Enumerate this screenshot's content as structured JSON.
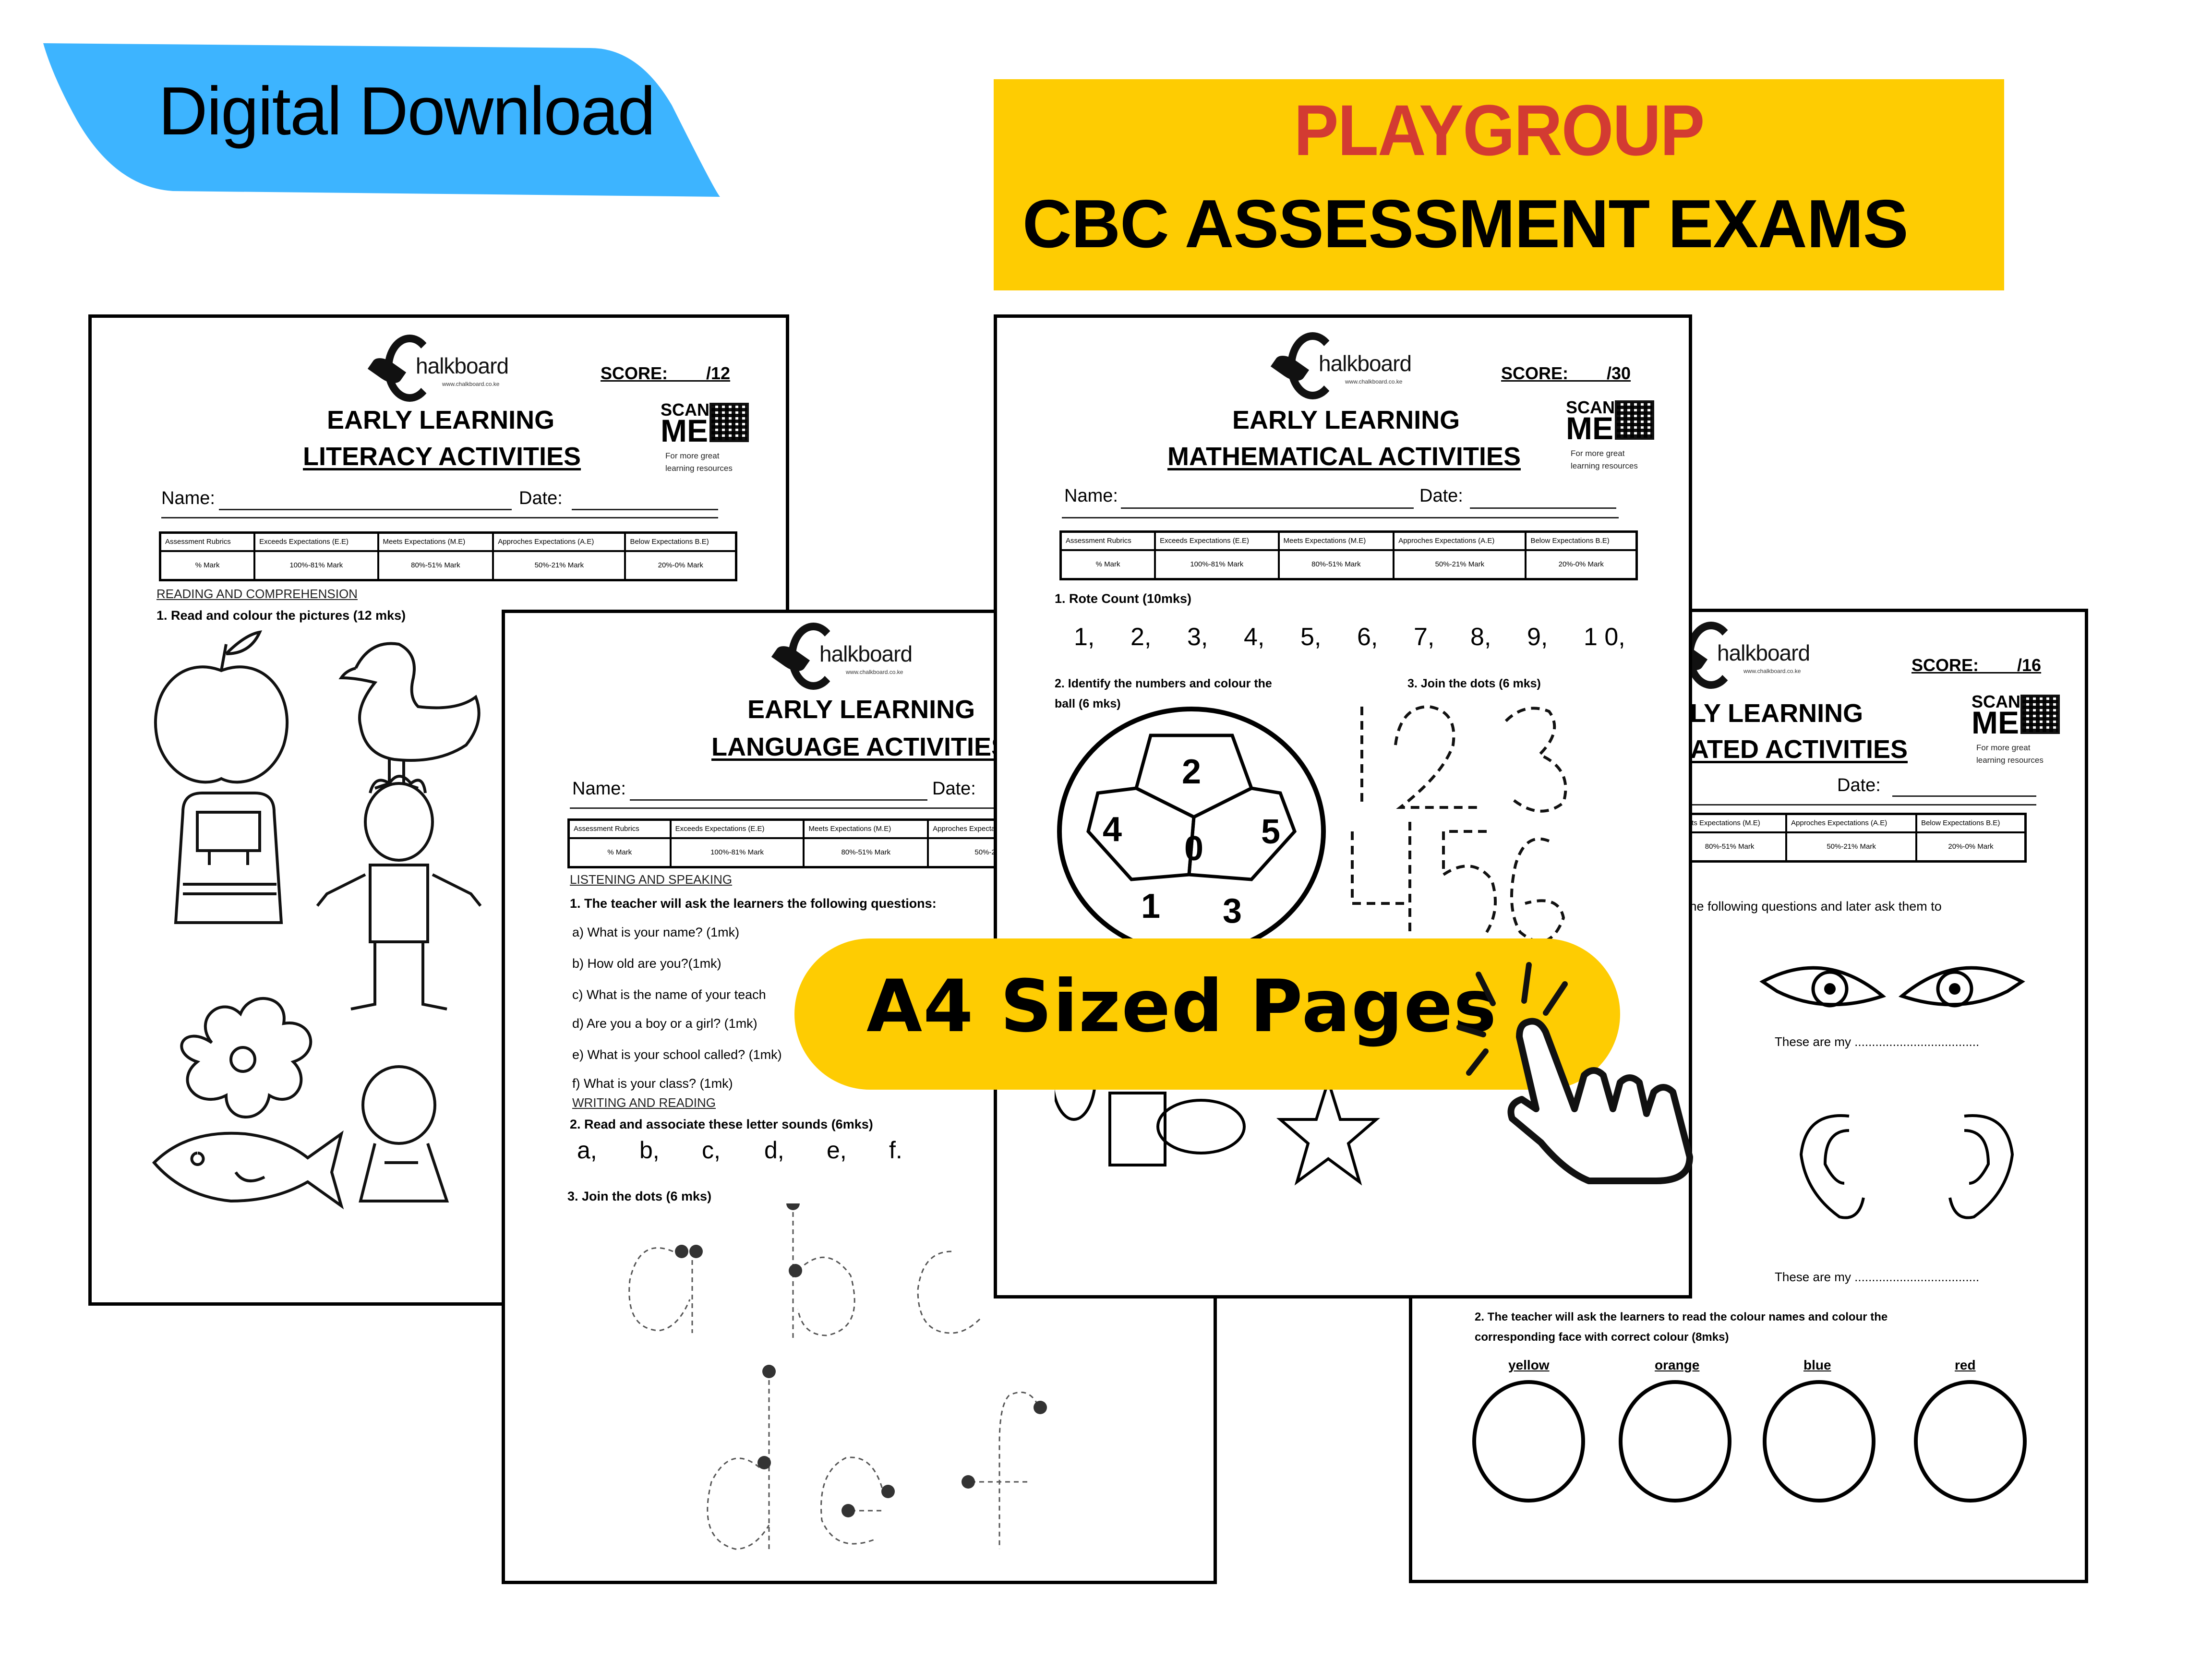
{
  "banner": {
    "label": "Digital Download",
    "color": "#3db4ff"
  },
  "title": {
    "line1": "PLAYGROUP",
    "line2": "CBC ASSESSMENT EXAMS",
    "bg_color": "#fecc02",
    "line1_color": "#d33b32"
  },
  "badge": {
    "label": "A4 Sized Pages",
    "color": "#fecc02"
  },
  "common": {
    "logo_word": "halkboard",
    "logo_url": "www.chalkboard.co.ke",
    "heading": "EARLY LEARNING",
    "scan1": "SCAN",
    "scan2": "ME",
    "scan3a": "For more great",
    "scan3b": "learning resources",
    "name_label": "Name:",
    "date_label": "Date:",
    "rubric": {
      "headers": [
        "Assessment Rubrics",
        "Exceeds Expectations (E.E)",
        "Meets Expectations (M.E)",
        "Approches Expectations (A.E)",
        "Below Expectations B.E)"
      ],
      "row": [
        "% Mark",
        "100%-81% Mark",
        "80%-51% Mark",
        "50%-21% Mark",
        "20%-0%  Mark"
      ]
    }
  },
  "pages": {
    "literacy": {
      "score": "SCORE:        /12",
      "subtitle": "LITERACY ACTIVITIES",
      "section": "READING AND COMPREHENSION",
      "q1": "1. Read and colour the pictures (12 mks)",
      "pictures": [
        "apple",
        "duck",
        "backpack",
        "boy",
        "flower",
        "fish",
        "girl"
      ]
    },
    "language": {
      "subtitle": "LANGUAGE ACTIVITIES",
      "section1": "LISTENING AND SPEAKING",
      "q1": "1. The teacher will ask the learners the following questions:",
      "questions": [
        "a) What is your name? (1mk)",
        "b) How old are you?(1mk)",
        "c) What is the name of your teach",
        "d) Are you a boy or a girl? (1mk)",
        "e) What is your school called? (1mk)",
        "f) What is your class? (1mk)"
      ],
      "section2": "WRITING AND READING",
      "q2": "2. Read and associate these letter sounds (6mks)",
      "letters": [
        "a,",
        "b,",
        "c,",
        "d,",
        "e,",
        "f."
      ],
      "q3": "3. Join the dots (6 mks)"
    },
    "math": {
      "score": "SCORE:        /30",
      "subtitle": "MATHEMATICAL ACTIVITIES",
      "q1": "1. Rote Count (10mks)",
      "rote": [
        "1,",
        "2,",
        "3,",
        "4,",
        "5,",
        "6,",
        "7,",
        "8,",
        "9,",
        "1 0,"
      ],
      "q2a": "2. Identify the numbers and colour the",
      "q2b": "ball  (6 mks)",
      "ball_numbers": [
        "2",
        "4",
        "0",
        "5",
        "1",
        "3"
      ],
      "q3": "3. Join the dots (6 mks)",
      "trace_digits": [
        "1",
        "2",
        "3",
        "4",
        "5",
        "6"
      ]
    },
    "integrated": {
      "score": "SCORE:        /16",
      "heading_partial": "RLY LEARNING",
      "subtitle": "RATED  ACTIVITIES",
      "q1_partial": "rs the following questions and later ask them to",
      "these_are_my": "These are my ....................................",
      "q2a": "2. The teacher will ask the learners to read the colour names and colour the",
      "q2b": "corresponding face with correct colour  (8mks)",
      "colours": [
        "yellow",
        "orange",
        "blue",
        "red"
      ]
    }
  }
}
